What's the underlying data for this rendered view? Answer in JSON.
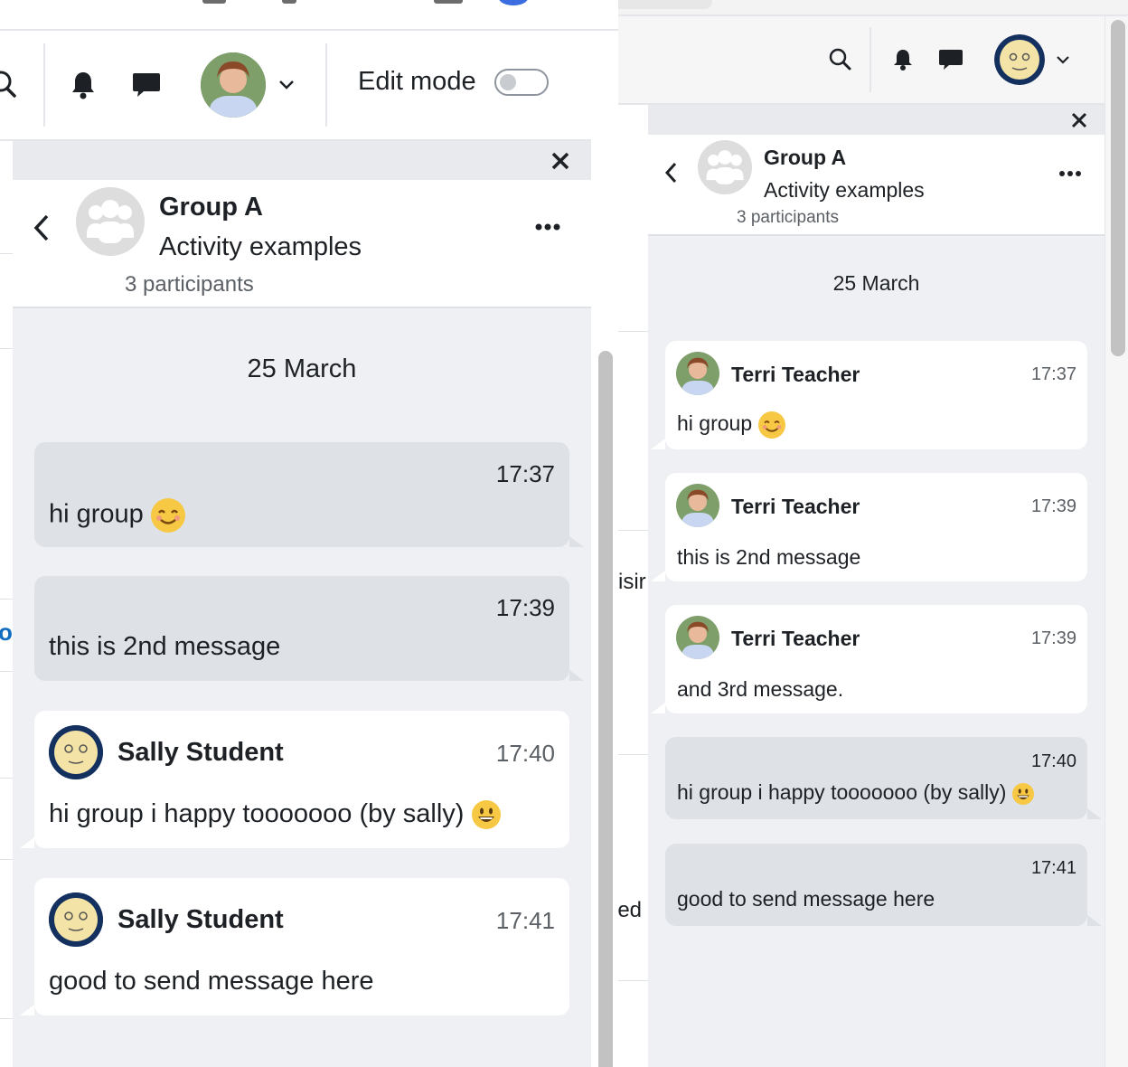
{
  "left": {
    "navbar": {
      "edit_mode_label": "Edit mode",
      "icons": [
        "search-icon",
        "bell-icon",
        "chat-icon",
        "chevron-down-icon"
      ]
    },
    "header": {
      "title": "Group A",
      "subtitle": "Activity examples",
      "participants": "3 participants"
    },
    "date": "25 March",
    "messages": [
      {
        "own": true,
        "time": "17:37",
        "text": "hi group",
        "emoji": "smiling-face-emoji"
      },
      {
        "own": true,
        "time": "17:39",
        "text": "this is 2nd message"
      },
      {
        "own": false,
        "author": "Sally Student",
        "time": "17:40",
        "text": "hi group i happy tooooooo (by sally)",
        "emoji": "grinning-face-emoji"
      },
      {
        "own": false,
        "author": "Sally Student",
        "time": "17:41",
        "text": "good to send message here"
      }
    ],
    "fragments": {
      "link_fragment": "o"
    }
  },
  "right": {
    "header": {
      "title": "Group A",
      "subtitle": "Activity examples",
      "participants": "3 participants"
    },
    "date": "25 March",
    "messages": [
      {
        "own": false,
        "author": "Terri Teacher",
        "time": "17:37",
        "text": "hi group",
        "emoji": "smiling-face-emoji"
      },
      {
        "own": false,
        "author": "Terri Teacher",
        "time": "17:39",
        "text": "this is 2nd message"
      },
      {
        "own": false,
        "author": "Terri Teacher",
        "time": "17:39",
        "text": "and 3rd message."
      },
      {
        "own": true,
        "time": "17:40",
        "text": "hi group i happy tooooooo (by sally)",
        "emoji": "grinning-face-emoji"
      },
      {
        "own": true,
        "time": "17:41",
        "text": "good to send message here"
      }
    ],
    "fragments": {
      "frag1": "isir",
      "frag2": "led"
    }
  },
  "colors": {
    "drawer_bg": "#eff0f3",
    "own_bubble": "#dee2e6",
    "other_bubble": "#ffffff",
    "accent_blue": "#0f6cbf"
  }
}
